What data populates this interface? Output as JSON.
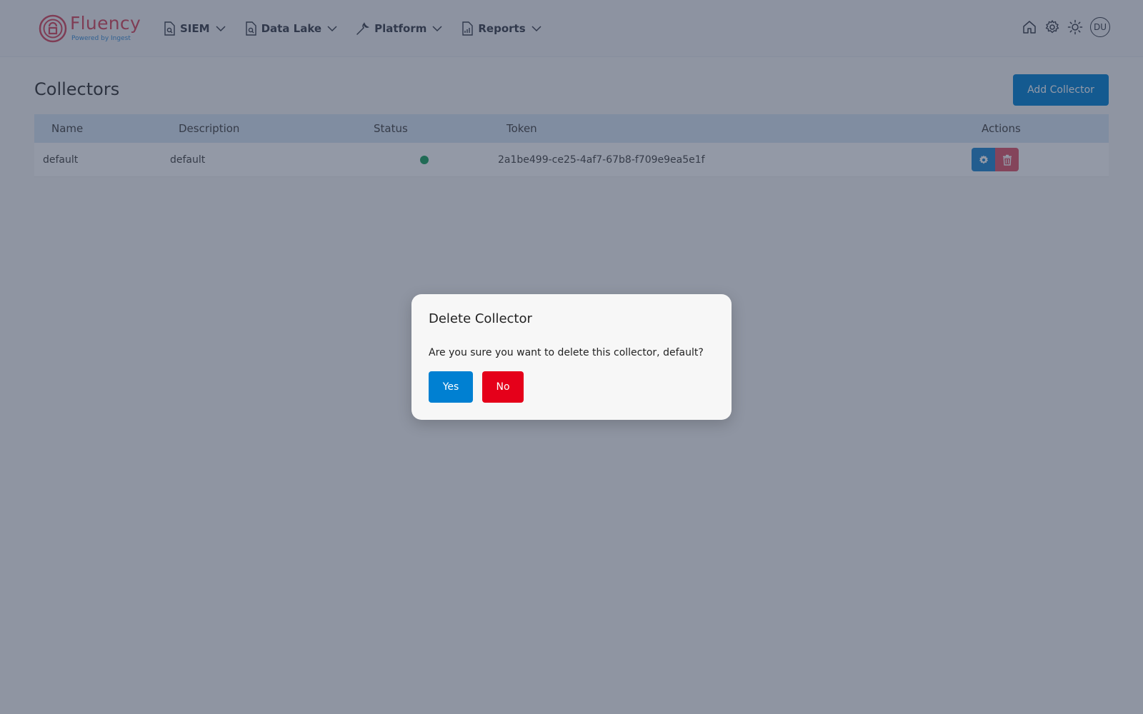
{
  "brand": {
    "name": "Fluency",
    "tagline": "Powered by Ingest"
  },
  "nav": {
    "items": [
      {
        "label": "SIEM",
        "icon": "search-document-icon"
      },
      {
        "label": "Data Lake",
        "icon": "search-document-icon"
      },
      {
        "label": "Platform",
        "icon": "wrench-icon"
      },
      {
        "label": "Reports",
        "icon": "report-chart-icon"
      }
    ]
  },
  "header_right": {
    "icons": [
      "home-icon",
      "gear-icon",
      "sun-icon"
    ],
    "avatar_initials": "DU"
  },
  "page": {
    "title": "Collectors",
    "add_button": "Add Collector"
  },
  "table": {
    "headers": [
      "Name",
      "Description",
      "Status",
      "Token",
      "Actions"
    ],
    "rows": [
      {
        "name": "default",
        "description": "default",
        "status": "active",
        "token": "2a1be499-ce25-4af7-67b8-f709e9ea5e1f"
      }
    ]
  },
  "modal": {
    "title": "Delete Collector",
    "message": "Are you sure you want to delete this collector, default?",
    "yes": "Yes",
    "no": "No"
  },
  "colors": {
    "accent": "#0080d2",
    "danger": "#e5001a",
    "brand": "#d7475c",
    "status_ok": "#1aa35f"
  }
}
